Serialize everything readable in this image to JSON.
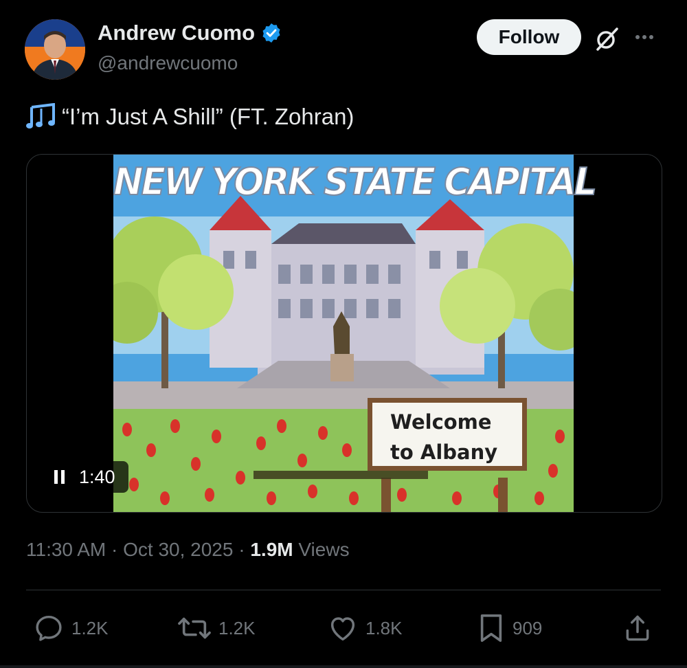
{
  "author": {
    "name": "Andrew Cuomo",
    "handle": "@andrewcuomo",
    "verified": true,
    "avatar_icon": "profile-photo"
  },
  "header": {
    "follow_label": "Follow",
    "grok_icon": "slashed-circle-icon",
    "more_icon": "more-dots-icon"
  },
  "post": {
    "emoji": "musical-notes",
    "text": "“I’m Just A Shill” (FT. Zohran)"
  },
  "video": {
    "frame_title": "NEW YORK STATE CAPITAL",
    "sign_line1": "Welcome",
    "sign_line2": "to Albany",
    "duration": "1:40",
    "state": "playing"
  },
  "meta": {
    "time": "11:30 AM",
    "separator": "·",
    "date": "Oct 30, 2025",
    "views_count": "1.9M",
    "views_label": "Views"
  },
  "actions": {
    "replies": "1.2K",
    "reposts": "1.2K",
    "likes": "1.8K",
    "bookmarks": "909"
  },
  "colors": {
    "background": "#000000",
    "text_primary": "#e7e9ea",
    "text_secondary": "#71767b",
    "verified_blue": "#1d9bf0",
    "follow_bg": "#eff3f4"
  }
}
